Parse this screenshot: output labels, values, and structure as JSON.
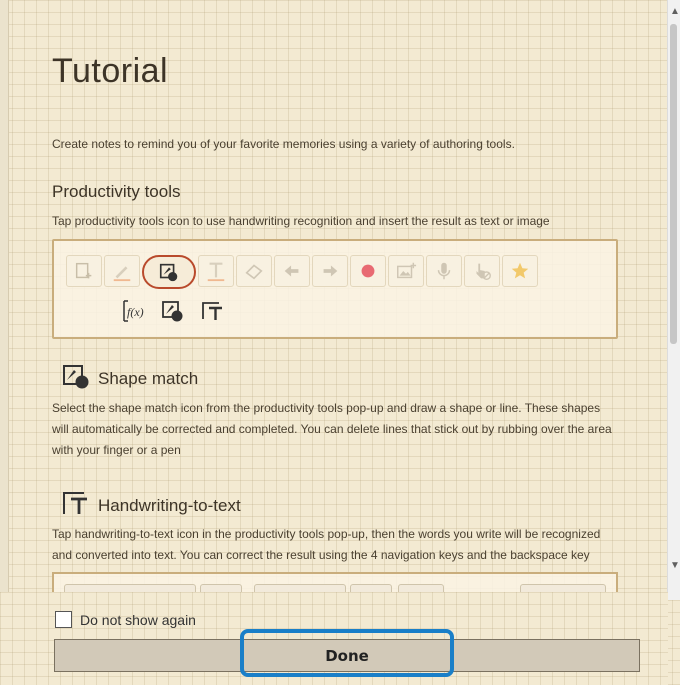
{
  "title": "Tutorial",
  "intro": "Create notes to remind you of your favorite memories using a variety of authoring tools.",
  "productivity": {
    "heading": "Productivity tools",
    "description": "Tap productivity tools icon to use handwriting recognition and insert the result as text or image",
    "toolbar_icons": [
      "new-page-icon",
      "pen-icon",
      "productivity-tools-icon",
      "text-icon",
      "eraser-icon",
      "undo-icon",
      "redo-icon",
      "record-icon",
      "insert-image-icon",
      "microphone-icon",
      "touch-disable-icon",
      "favorite-star-icon"
    ],
    "sub_icons": [
      "formula-match-icon",
      "shape-match-icon",
      "handwriting-to-text-icon"
    ],
    "highlight_color": "#b94a2c"
  },
  "shape_match": {
    "heading": "Shape match",
    "description": "Select the shape match icon from the productivity tools pop-up and draw a shape or line. These shapes will automatically be corrected and completed. You can delete lines that stick out by rubbing over the area with your finger or a pen"
  },
  "handwriting": {
    "heading": "Handwriting-to-text",
    "description": "Tap handwriting-to-text icon in the productivity tools pop-up, then the words you write will be recognized and converted into text. You can correct the result using the 4 navigation keys and the backspace key"
  },
  "footer": {
    "checkbox_label": "Do not show again",
    "checkbox_checked": false,
    "done_label": "Done",
    "focus_color": "#1a7fc8"
  }
}
